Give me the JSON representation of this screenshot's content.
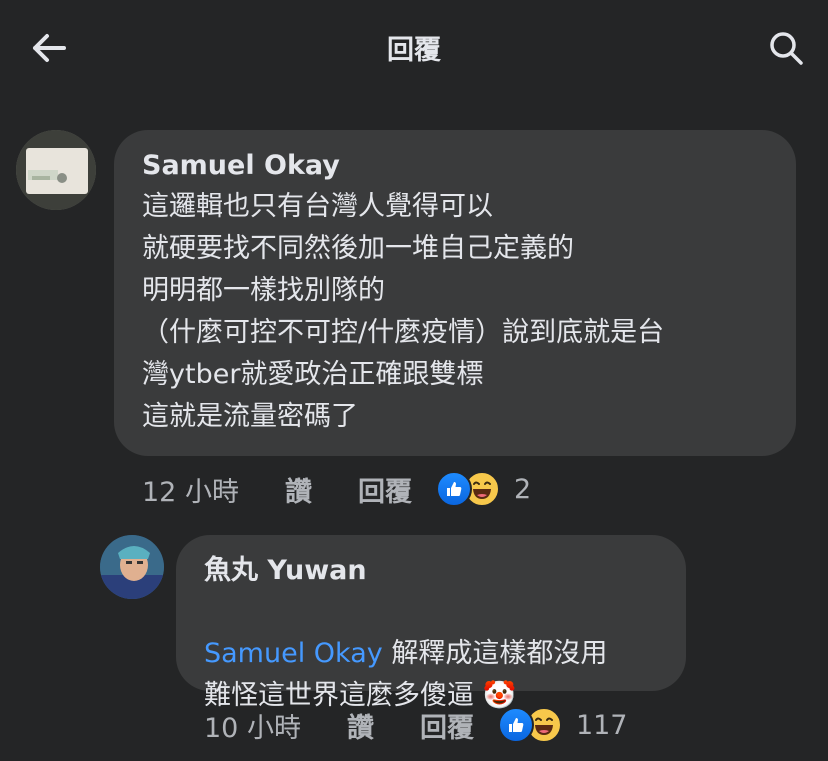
{
  "header": {
    "title": "回覆"
  },
  "comments": [
    {
      "author": "Samuel Okay",
      "lines": "這邏輯也只有台灣人覺得可以\n就硬要找不同然後加一堆自己定義的\n明明都一樣找別隊的\n（什麼可控不可控/什麼疫情）說到底就是台\n灣ytber就愛政治正確跟雙標\n這就是流量密碼了",
      "time": "12 小時",
      "like_label": "讚",
      "reply_label": "回覆",
      "reaction_count": "2",
      "reactions": [
        "like-icon",
        "haha-icon"
      ]
    },
    {
      "author": "魚丸 Yuwan",
      "mention": "Samuel Okay",
      "text_after_mention": " 解釋成這樣都沒用",
      "line2": "難怪這世界這麼多傻逼 🤡",
      "time": "10 小時",
      "like_label": "讚",
      "reply_label": "回覆",
      "reaction_count": "117",
      "reactions": [
        "like-icon",
        "haha-icon"
      ]
    }
  ],
  "colors": {
    "background": "#242526",
    "bubble": "#3a3b3c",
    "text": "#e4e6eb",
    "meta": "#b0b3b8",
    "mention": "#4599ff",
    "like": "#1877f2",
    "haha": "#f7c84b"
  }
}
